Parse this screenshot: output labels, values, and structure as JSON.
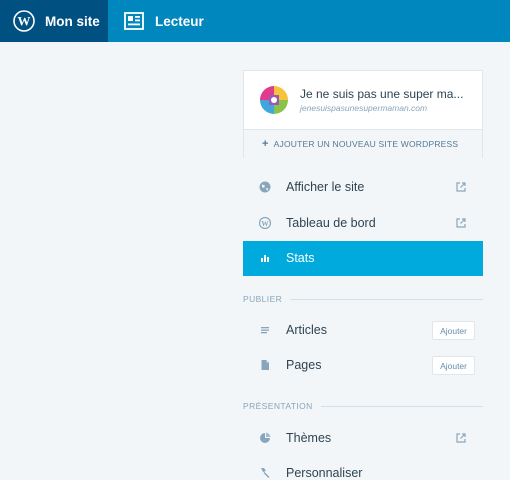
{
  "masterbar": {
    "my_site_label": "Mon site",
    "reader_label": "Lecteur"
  },
  "site": {
    "title": "Je ne suis pas une super ma...",
    "domain": "jenesuispasunesupermaman.com",
    "add_site_label": "AJOUTER UN NOUVEAU SITE WORDPRESS"
  },
  "menu": {
    "view_site": "Afficher le site",
    "dashboard": "Tableau de bord",
    "stats": "Stats",
    "publish_heading": "PUBLIER",
    "articles": "Articles",
    "articles_add": "Ajouter",
    "pages": "Pages",
    "pages_add": "Ajouter",
    "presentation_heading": "PRÉSENTATION",
    "themes": "Thèmes",
    "customize": "Personnaliser"
  },
  "colors": {
    "masterbar": "#0087be",
    "masterbar_active": "#005082",
    "accent": "#00aadc",
    "background": "#f3f6f8"
  }
}
